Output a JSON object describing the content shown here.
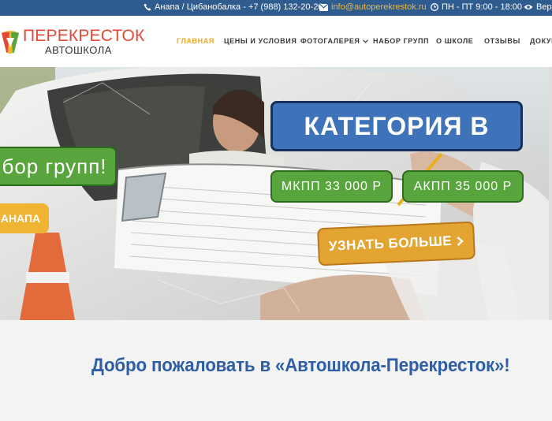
{
  "topbar": {
    "phone_icon": "phone-icon",
    "contact": "Анапа / Цибанобалка - +7 (988) 132-20-20",
    "mail_icon": "envelope-icon",
    "email": "info@autoperekrestok.ru",
    "clock_icon": "clock-icon",
    "hours": "ПН - ПТ 9:00 - 18:00",
    "eye_icon": "eye-icon",
    "accessibility": "Верс"
  },
  "logo": {
    "brand": "ПЕРЕКРЕСТОК",
    "sub": "АВТОШКОЛА"
  },
  "nav": {
    "items": [
      {
        "label": "ГЛАВНАЯ",
        "active": true
      },
      {
        "label": "ЦЕНЫ И УСЛОВИЯ"
      },
      {
        "label": "ФОТОГАЛЕРЕЯ",
        "dropdown": true
      },
      {
        "label": "НАБОР ГРУПП"
      },
      {
        "label": "О ШКОЛЕ"
      },
      {
        "label": "ОТЗЫВЫ"
      },
      {
        "label": "ДОКУМ"
      }
    ]
  },
  "hero": {
    "category": "КАТЕГОРИЯ В",
    "recruitment": "бор групп!",
    "city": "АНАПА",
    "manual_price": "МКПП 33 000 Р",
    "auto_price": "АКПП 35 000 Р",
    "more_button": "УЗНАТЬ БОЛЬШЕ"
  },
  "welcome": {
    "title": "Добро пожаловать в «Автошкола-Перекресток»!"
  },
  "colors": {
    "topbar": "#2f5c8f",
    "accent": "#f2a623",
    "category_blue": "#3e73b9",
    "price_green": "#58a53d",
    "title_blue": "#2e5ea3"
  }
}
